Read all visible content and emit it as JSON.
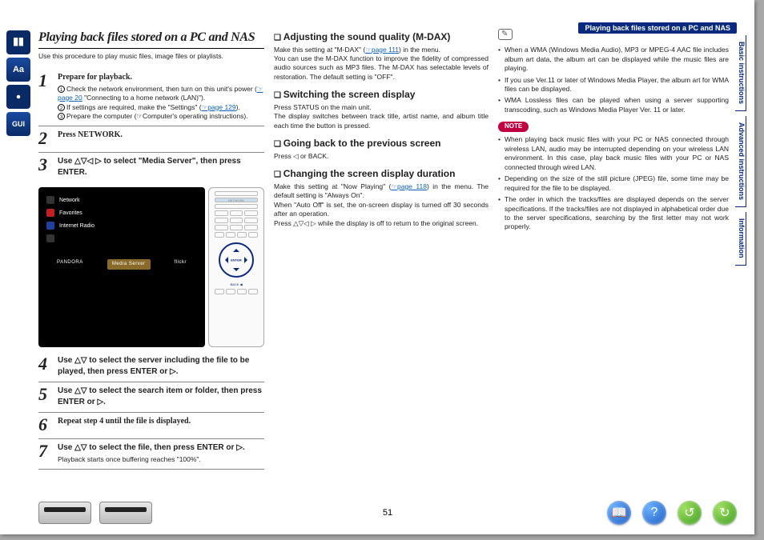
{
  "breadcrumb": "Playing back files stored on a PC and NAS",
  "rail": {
    "i1": "book-icon",
    "i2": "Aa",
    "i3": "gear-icon",
    "i4": "GUI"
  },
  "vtabs": [
    "Basic instructions",
    "Advanced instructions",
    "Information"
  ],
  "col1": {
    "title": "Playing back files stored on a PC and NAS",
    "sub": "Use this procedure to play music files, image files or playlists.",
    "steps": [
      {
        "n": "1",
        "head": "Prepare for playback.",
        "details": [
          {
            "c": "1",
            "t": "Check the network environment, then turn on this unit's power (",
            "link": "page 20",
            "t2": " \"Connecting to a home network (LAN)\")."
          },
          {
            "c": "2",
            "t": "If settings are required, make the \"Settings\" (",
            "link": "page 129",
            "t2": ")."
          },
          {
            "c": "3",
            "t": "Prepare the computer (",
            "link": "",
            "t2": "Computer's operating instructions)."
          }
        ]
      },
      {
        "n": "2",
        "head": "Press NETWORK."
      },
      {
        "n": "3",
        "head": "Use △▽◁ ▷ to select \"Media Server\", then press ENTER."
      },
      {
        "n": "4",
        "head": "Use △▽ to select the server including the file to be played, then press ENTER or ▷."
      },
      {
        "n": "5",
        "head": "Use △▽ to select the search item or folder, then press ENTER or ▷."
      },
      {
        "n": "6",
        "head": "Repeat step 4 until the file is displayed."
      },
      {
        "n": "7",
        "head": "Use △▽ to select the file, then press ENTER or ▷.",
        "detail_plain": "Playback starts once buffering reaches \"100%\"."
      }
    ],
    "tv": {
      "items": [
        {
          "cls": "",
          "label": "Network"
        },
        {
          "cls": "red",
          "label": "Favorites"
        },
        {
          "cls": "blue",
          "label": "Internet Radio"
        },
        {
          "cls": "",
          "label": ""
        }
      ],
      "sel": "Media Server",
      "brands": [
        "PANDORA",
        "",
        "flickr"
      ]
    }
  },
  "col2": {
    "s1": {
      "h": "Adjusting the sound quality (M-DAX)",
      "p": "Make this setting at \"M-DAX\" (",
      "link": "page 111",
      "p2": ") in the menu.\nYou can use the M-DAX function to improve the fidelity of compressed audio sources such as MP3 files. The M-DAX has selectable levels of restoration. The default setting is \"OFF\"."
    },
    "s2": {
      "h": "Switching the screen display",
      "p": "Press STATUS on the main unit.\nThe display switches between track title, artist name, and album title each time the button is pressed."
    },
    "s3": {
      "h": "Going back to the previous screen",
      "p": "Press ◁ or BACK."
    },
    "s4": {
      "h": "Changing the screen display duration",
      "p": "Make this setting at \"Now Playing\" (",
      "link": "page 118",
      "p2": ") in the menu. The default setting is \"Always On\".\nWhen \"Auto Off\" is set, the on-screen display is turned off 30 seconds after an operation.\nPress △▽◁ ▷ while the display is off to return to the original screen."
    }
  },
  "col3": {
    "bullets1": [
      "When a WMA (Windows Media Audio), MP3 or MPEG-4 AAC file includes album art data, the album art can be displayed while the music files are playing.",
      "If you use Ver.11 or later of Windows Media Player, the album art for WMA files can be displayed.",
      "WMA Lossless files can be played when using a server supporting transcoding, such as Windows Media Player Ver. 11 or later."
    ],
    "note_label": "NOTE",
    "bullets2": [
      "When playing back music files with your PC or NAS connected through wireless LAN, audio may be interrupted depending on your wireless LAN environment. In this case, play back music files with your PC or NAS connected through wired LAN.",
      "Depending on the size of the still picture (JPEG) file, some time may be required for the file to be displayed.",
      "The order in which the tracks/files are displayed depends on the server specifications. If the tracks/files are not displayed in alphabetical order due to the server specifications, searching by the first letter may not work properly."
    ]
  },
  "footer": {
    "page": "51",
    "nav": {
      "book": "📖",
      "help": "?",
      "prev": "↺",
      "next": "↻"
    }
  }
}
